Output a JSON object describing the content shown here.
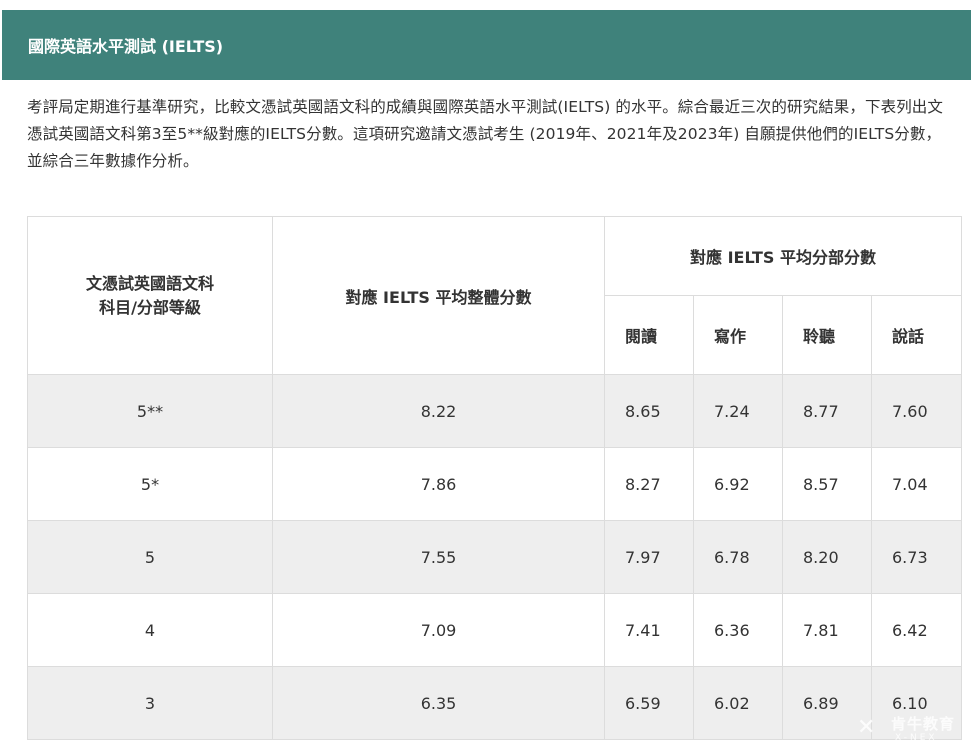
{
  "header": {
    "title": "國際英語水平測試 (IELTS)"
  },
  "intro": "考評局定期進行基準研究，比較文憑試英國語文科的成績與國際英語水平測試(IELTS) 的水平。綜合最近三次的研究結果，下表列出文憑試英國語文科第3至5**級對應的IELTS分數。這項研究邀請文憑試考生 (2019年、2021年及2023年) 自願提供他們的IELTS分數，並綜合三年數據作分析。",
  "table": {
    "subject_header": "文憑試英國語文科\n科目/分部等級",
    "overall_header": "對應 IELTS 平均整體分數",
    "sub_group_header": "對應 IELTS 平均分部分數",
    "sub_headers": [
      "閱讀",
      "寫作",
      "聆聽",
      "說話"
    ],
    "rows": [
      {
        "grade": "5**",
        "overall": "8.22",
        "reading": "8.65",
        "writing": "7.24",
        "listening": "8.77",
        "speaking": "7.60"
      },
      {
        "grade": "5*",
        "overall": "7.86",
        "reading": "8.27",
        "writing": "6.92",
        "listening": "8.57",
        "speaking": "7.04"
      },
      {
        "grade": "5",
        "overall": "7.55",
        "reading": "7.97",
        "writing": "6.78",
        "listening": "8.20",
        "speaking": "6.73"
      },
      {
        "grade": "4",
        "overall": "7.09",
        "reading": "7.41",
        "writing": "6.36",
        "listening": "7.81",
        "speaking": "6.42"
      },
      {
        "grade": "3",
        "overall": "6.35",
        "reading": "6.59",
        "writing": "6.02",
        "listening": "6.89",
        "speaking": "6.10"
      }
    ]
  },
  "watermark": {
    "brand_cn": "肯牛教育",
    "brand_en": "X-NEX"
  },
  "colors": {
    "header_bg": "#3f827b",
    "row_alt_bg": "#eeeeee",
    "border": "#dcdcdc"
  }
}
